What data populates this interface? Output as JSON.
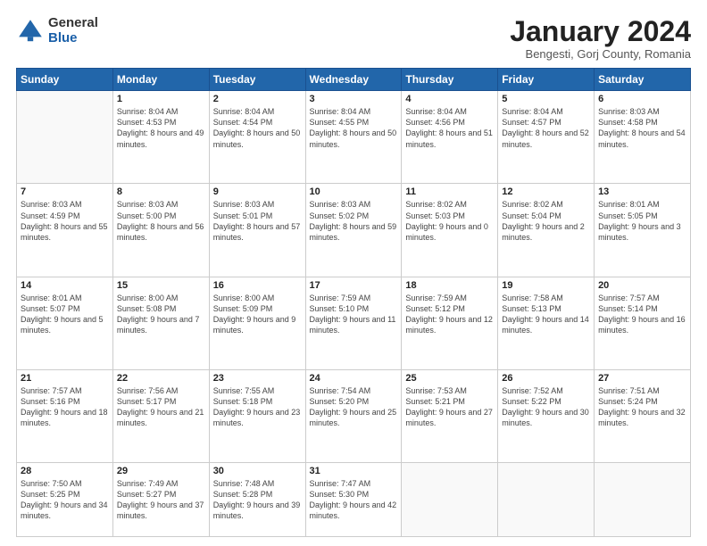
{
  "logo": {
    "general": "General",
    "blue": "Blue"
  },
  "header": {
    "month": "January 2024",
    "location": "Bengesti, Gorj County, Romania"
  },
  "weekdays": [
    "Sunday",
    "Monday",
    "Tuesday",
    "Wednesday",
    "Thursday",
    "Friday",
    "Saturday"
  ],
  "weeks": [
    [
      {
        "day": "",
        "sunrise": "",
        "sunset": "",
        "daylight": ""
      },
      {
        "day": "1",
        "sunrise": "Sunrise: 8:04 AM",
        "sunset": "Sunset: 4:53 PM",
        "daylight": "Daylight: 8 hours and 49 minutes."
      },
      {
        "day": "2",
        "sunrise": "Sunrise: 8:04 AM",
        "sunset": "Sunset: 4:54 PM",
        "daylight": "Daylight: 8 hours and 50 minutes."
      },
      {
        "day": "3",
        "sunrise": "Sunrise: 8:04 AM",
        "sunset": "Sunset: 4:55 PM",
        "daylight": "Daylight: 8 hours and 50 minutes."
      },
      {
        "day": "4",
        "sunrise": "Sunrise: 8:04 AM",
        "sunset": "Sunset: 4:56 PM",
        "daylight": "Daylight: 8 hours and 51 minutes."
      },
      {
        "day": "5",
        "sunrise": "Sunrise: 8:04 AM",
        "sunset": "Sunset: 4:57 PM",
        "daylight": "Daylight: 8 hours and 52 minutes."
      },
      {
        "day": "6",
        "sunrise": "Sunrise: 8:03 AM",
        "sunset": "Sunset: 4:58 PM",
        "daylight": "Daylight: 8 hours and 54 minutes."
      }
    ],
    [
      {
        "day": "7",
        "sunrise": "Sunrise: 8:03 AM",
        "sunset": "Sunset: 4:59 PM",
        "daylight": "Daylight: 8 hours and 55 minutes."
      },
      {
        "day": "8",
        "sunrise": "Sunrise: 8:03 AM",
        "sunset": "Sunset: 5:00 PM",
        "daylight": "Daylight: 8 hours and 56 minutes."
      },
      {
        "day": "9",
        "sunrise": "Sunrise: 8:03 AM",
        "sunset": "Sunset: 5:01 PM",
        "daylight": "Daylight: 8 hours and 57 minutes."
      },
      {
        "day": "10",
        "sunrise": "Sunrise: 8:03 AM",
        "sunset": "Sunset: 5:02 PM",
        "daylight": "Daylight: 8 hours and 59 minutes."
      },
      {
        "day": "11",
        "sunrise": "Sunrise: 8:02 AM",
        "sunset": "Sunset: 5:03 PM",
        "daylight": "Daylight: 9 hours and 0 minutes."
      },
      {
        "day": "12",
        "sunrise": "Sunrise: 8:02 AM",
        "sunset": "Sunset: 5:04 PM",
        "daylight": "Daylight: 9 hours and 2 minutes."
      },
      {
        "day": "13",
        "sunrise": "Sunrise: 8:01 AM",
        "sunset": "Sunset: 5:05 PM",
        "daylight": "Daylight: 9 hours and 3 minutes."
      }
    ],
    [
      {
        "day": "14",
        "sunrise": "Sunrise: 8:01 AM",
        "sunset": "Sunset: 5:07 PM",
        "daylight": "Daylight: 9 hours and 5 minutes."
      },
      {
        "day": "15",
        "sunrise": "Sunrise: 8:00 AM",
        "sunset": "Sunset: 5:08 PM",
        "daylight": "Daylight: 9 hours and 7 minutes."
      },
      {
        "day": "16",
        "sunrise": "Sunrise: 8:00 AM",
        "sunset": "Sunset: 5:09 PM",
        "daylight": "Daylight: 9 hours and 9 minutes."
      },
      {
        "day": "17",
        "sunrise": "Sunrise: 7:59 AM",
        "sunset": "Sunset: 5:10 PM",
        "daylight": "Daylight: 9 hours and 11 minutes."
      },
      {
        "day": "18",
        "sunrise": "Sunrise: 7:59 AM",
        "sunset": "Sunset: 5:12 PM",
        "daylight": "Daylight: 9 hours and 12 minutes."
      },
      {
        "day": "19",
        "sunrise": "Sunrise: 7:58 AM",
        "sunset": "Sunset: 5:13 PM",
        "daylight": "Daylight: 9 hours and 14 minutes."
      },
      {
        "day": "20",
        "sunrise": "Sunrise: 7:57 AM",
        "sunset": "Sunset: 5:14 PM",
        "daylight": "Daylight: 9 hours and 16 minutes."
      }
    ],
    [
      {
        "day": "21",
        "sunrise": "Sunrise: 7:57 AM",
        "sunset": "Sunset: 5:16 PM",
        "daylight": "Daylight: 9 hours and 18 minutes."
      },
      {
        "day": "22",
        "sunrise": "Sunrise: 7:56 AM",
        "sunset": "Sunset: 5:17 PM",
        "daylight": "Daylight: 9 hours and 21 minutes."
      },
      {
        "day": "23",
        "sunrise": "Sunrise: 7:55 AM",
        "sunset": "Sunset: 5:18 PM",
        "daylight": "Daylight: 9 hours and 23 minutes."
      },
      {
        "day": "24",
        "sunrise": "Sunrise: 7:54 AM",
        "sunset": "Sunset: 5:20 PM",
        "daylight": "Daylight: 9 hours and 25 minutes."
      },
      {
        "day": "25",
        "sunrise": "Sunrise: 7:53 AM",
        "sunset": "Sunset: 5:21 PM",
        "daylight": "Daylight: 9 hours and 27 minutes."
      },
      {
        "day": "26",
        "sunrise": "Sunrise: 7:52 AM",
        "sunset": "Sunset: 5:22 PM",
        "daylight": "Daylight: 9 hours and 30 minutes."
      },
      {
        "day": "27",
        "sunrise": "Sunrise: 7:51 AM",
        "sunset": "Sunset: 5:24 PM",
        "daylight": "Daylight: 9 hours and 32 minutes."
      }
    ],
    [
      {
        "day": "28",
        "sunrise": "Sunrise: 7:50 AM",
        "sunset": "Sunset: 5:25 PM",
        "daylight": "Daylight: 9 hours and 34 minutes."
      },
      {
        "day": "29",
        "sunrise": "Sunrise: 7:49 AM",
        "sunset": "Sunset: 5:27 PM",
        "daylight": "Daylight: 9 hours and 37 minutes."
      },
      {
        "day": "30",
        "sunrise": "Sunrise: 7:48 AM",
        "sunset": "Sunset: 5:28 PM",
        "daylight": "Daylight: 9 hours and 39 minutes."
      },
      {
        "day": "31",
        "sunrise": "Sunrise: 7:47 AM",
        "sunset": "Sunset: 5:30 PM",
        "daylight": "Daylight: 9 hours and 42 minutes."
      },
      {
        "day": "",
        "sunrise": "",
        "sunset": "",
        "daylight": ""
      },
      {
        "day": "",
        "sunrise": "",
        "sunset": "",
        "daylight": ""
      },
      {
        "day": "",
        "sunrise": "",
        "sunset": "",
        "daylight": ""
      }
    ]
  ]
}
